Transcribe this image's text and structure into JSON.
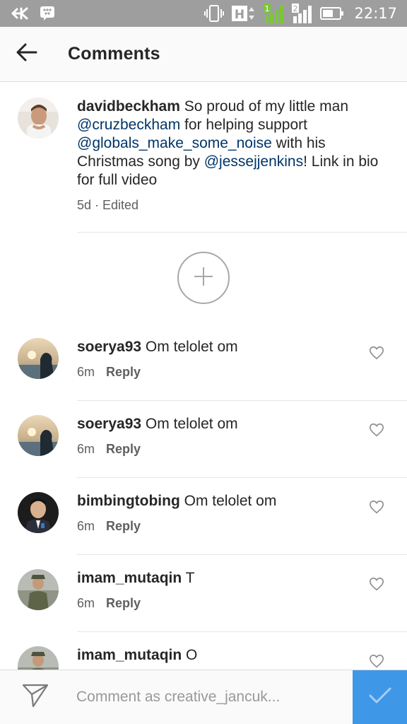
{
  "status_bar": {
    "time": "22:17",
    "sim_slot_1": "1",
    "sim_slot_2": "2",
    "network_badge": "H",
    "icons": [
      "vk-icon",
      "bbm-icon",
      "vibrate-icon",
      "h-network-icon",
      "signal-1-icon",
      "signal-2-icon",
      "battery-icon"
    ]
  },
  "header": {
    "back_icon": "arrow-left-icon",
    "title": "Comments"
  },
  "caption": {
    "username": "davidbeckham",
    "parts": [
      {
        "text": " So proud of my little man ",
        "mention": false
      },
      {
        "text": "@cruzbeckham",
        "mention": true
      },
      {
        "text": " for helping support ",
        "mention": false
      },
      {
        "text": "@globals_make_some_noise",
        "mention": true
      },
      {
        "text": " with his Christmas song by ",
        "mention": false
      },
      {
        "text": "@jessejjenkins",
        "mention": true
      },
      {
        "text": "! Link in bio for full video",
        "mention": false
      }
    ],
    "time": "5d",
    "separator": " · ",
    "edited": "Edited"
  },
  "load_more_icon": "plus-circle-icon",
  "comments": [
    {
      "username": "soerya93",
      "text": " Om telolet om",
      "time": "6m",
      "reply": "Reply",
      "avatar": "sunset-silhouette"
    },
    {
      "username": "soerya93",
      "text": " Om telolet om",
      "time": "6m",
      "reply": "Reply",
      "avatar": "sunset-silhouette"
    },
    {
      "username": "bimbingtobing",
      "text": " Om telolet om",
      "time": "6m",
      "reply": "Reply",
      "avatar": "portrait-suit"
    },
    {
      "username": "imam_mutaqin",
      "text": " T",
      "time": "6m",
      "reply": "Reply",
      "avatar": "soldier"
    },
    {
      "username": "imam_mutaqin",
      "text": " O",
      "time": "",
      "reply": "",
      "avatar": "soldier"
    }
  ],
  "compose": {
    "dm_icon": "paper-plane-icon",
    "placeholder": "Comment as creative_jancuk...",
    "post_icon": "checkmark-icon"
  },
  "colors": {
    "status_bar": "#9e9e9e",
    "header_bg": "#fafafa",
    "mention": "#003569",
    "meta": "#5f5f5f",
    "post_button": "#3f97e8",
    "signal_green": "#7cc63a"
  }
}
